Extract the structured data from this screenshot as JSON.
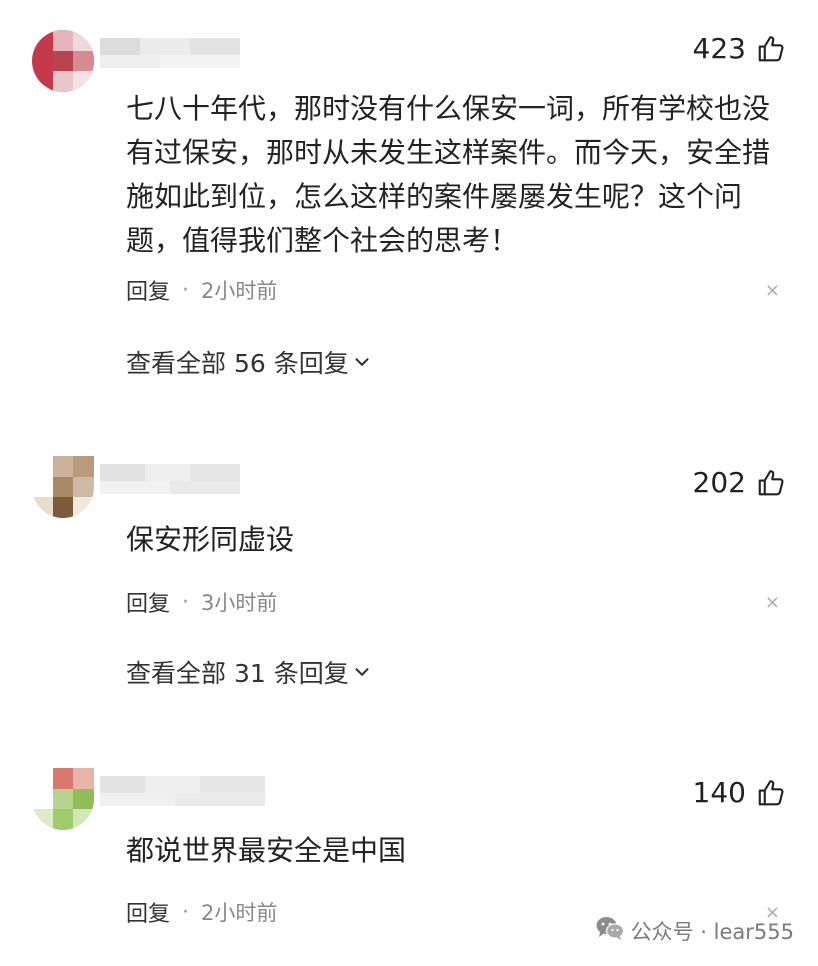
{
  "comments": [
    {
      "likes": "423",
      "text": "七八十年代，那时没有什么保安一词，所有学校也没有过保安，那时从未发生这样案件。而今天，安全措施如此到位，怎么这样的案件屡屡发生呢？这个问题，值得我们整个社会的思考！",
      "reply_label": "回复",
      "separator": "·",
      "time": "2小时前",
      "close_glyph": "×",
      "view_all": "查看全部 56 条回复"
    },
    {
      "likes": "202",
      "text": "保安形同虚设",
      "reply_label": "回复",
      "separator": "·",
      "time": "3小时前",
      "close_glyph": "×",
      "view_all": "查看全部 31 条回复"
    },
    {
      "likes": "140",
      "text": "都说世界最安全是中国",
      "reply_label": "回复",
      "separator": "·",
      "time": "2小时前",
      "close_glyph": "×"
    }
  ],
  "watermark": {
    "text": "公众号 · lear555",
    "icon": "wechat-icon"
  },
  "icons": {
    "like": "thumbs-up-icon",
    "expand": "chevron-down-icon",
    "close": "close-icon"
  },
  "colors": {
    "text": "#222222",
    "secondary": "#888888",
    "background": "#ffffff"
  }
}
